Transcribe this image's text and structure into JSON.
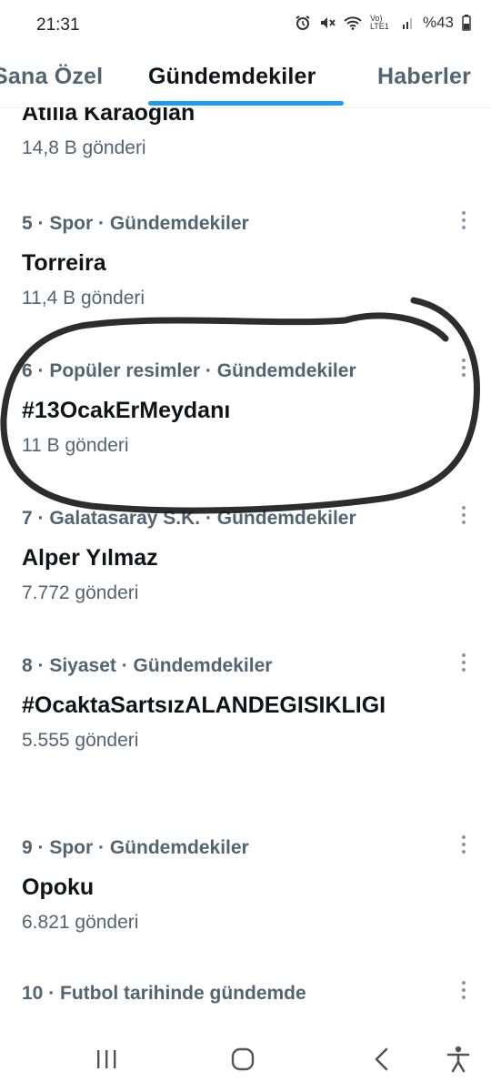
{
  "status_bar": {
    "time": "21:31",
    "network": "Vo) LTE1",
    "battery": "%43"
  },
  "tabs": [
    {
      "label": "Sana Özel",
      "active": false
    },
    {
      "label": "Gündemdekiler",
      "active": true
    },
    {
      "label": "Haberler",
      "active": false
    }
  ],
  "trends": [
    {
      "meta": "",
      "title": "Atilla Karaoğlan",
      "count": "14,8 B gönderi"
    },
    {
      "meta": "5 · Spor · Gündemdekiler",
      "title": "Torreira",
      "count": "11,4 B gönderi"
    },
    {
      "meta": "6 · Popüler resimler · Gündemdekiler",
      "title": "#13OcakErMeydanı",
      "count": "11 B gönderi"
    },
    {
      "meta": "7 · Galatasaray S.K. · Gündemdekiler",
      "title": "Alper Yılmaz",
      "count": "7.772 gönderi"
    },
    {
      "meta": "8 · Siyaset · Gündemdekiler",
      "title": "#OcaktaSartsızALANDEGISIKLIGI",
      "count": "5.555 gönderi"
    },
    {
      "meta": "9 · Spor · Gündemdekiler",
      "title": "Opoku",
      "count": "6.821 gönderi"
    },
    {
      "meta": "10 · Futbol tarihinde gündemde",
      "title": "",
      "count": ""
    }
  ],
  "colors": {
    "accent": "#1d9bf0",
    "text": "#0f1419",
    "secondary": "#536471"
  },
  "nav_icons": [
    "recent-apps-icon",
    "home-icon",
    "back-icon",
    "accessibility-icon"
  ]
}
